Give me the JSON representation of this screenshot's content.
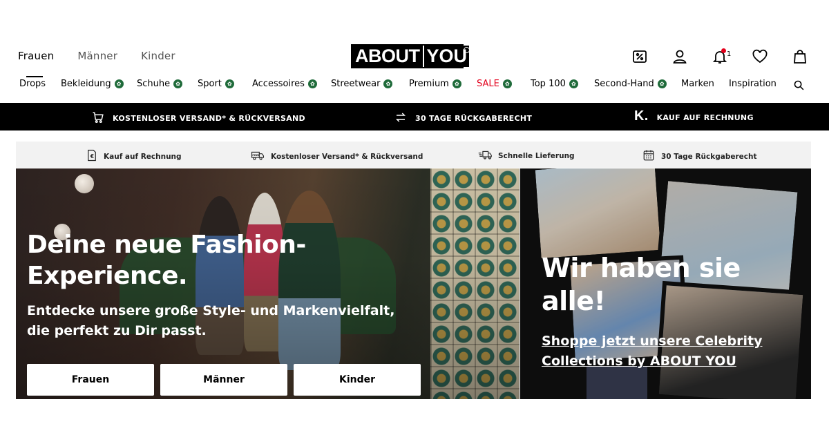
{
  "header": {
    "gender_tabs": [
      "Frauen",
      "Männer",
      "Kinder"
    ],
    "active_tab": "Frauen",
    "logo_text_1": "ABOUT",
    "logo_text_2": "YOU",
    "notification_count": "1",
    "icons": [
      "discount-icon",
      "user-icon",
      "bell-icon",
      "heart-icon",
      "bag-icon"
    ]
  },
  "categories": {
    "items": [
      "Drops",
      "Bekleidung",
      "Schuhe",
      "Sport",
      "Accessoires",
      "Streetwear",
      "Premium",
      "SALE",
      "Top 100",
      "Second-Hand",
      "Marken",
      "Inspiration"
    ]
  },
  "usp_black": {
    "shipping": "KOSTENLOSER VERSAND* & RÜCKVERSAND",
    "returns": "30 TAGE RÜCKGABERECHT",
    "invoice_logo": "K.",
    "invoice": "KAUF AUF RECHNUNG"
  },
  "usp_grey": {
    "invoice": "Kauf auf Rechnung",
    "shipping": "Kostenloser Versand* & Rückversand",
    "delivery": "Schnelle Lieferung",
    "returns": "30 Tage Rückgaberecht",
    "free_badge": "FREE"
  },
  "hero_left": {
    "title_line1": "Deine neue Fashion-",
    "title_line2": "Experience.",
    "subtitle": "Entdecke unsere große Style- und Markenvielfalt, die perfekt zu Dir passt.",
    "buttons": [
      "Frauen",
      "Männer",
      "Kinder"
    ]
  },
  "hero_right": {
    "title_line1": "Wir haben sie",
    "title_line2": "alle!",
    "link_line1": "Shoppe jetzt unsere Celebrity",
    "link_line2": "Collections by ABOUT YOU"
  },
  "colors": {
    "sale_red": "#e3001b",
    "leaf_green": "#1f6b3a",
    "banner_black": "#000000",
    "strip_grey": "#f2f2f2"
  }
}
